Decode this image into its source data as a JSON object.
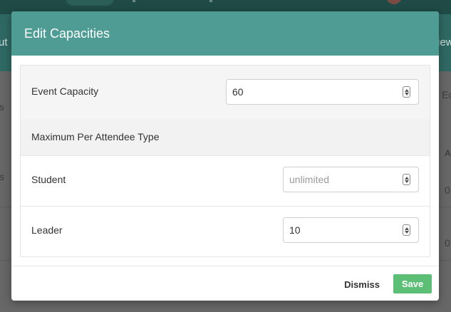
{
  "modal": {
    "title": "Edit Capacities",
    "event_capacity": {
      "label": "Event Capacity",
      "value": "60"
    },
    "max_per_type": {
      "heading": "Maximum Per Attendee Type",
      "rows": [
        {
          "label": "Student",
          "value": "",
          "placeholder": "unlimited"
        },
        {
          "label": "Leader",
          "value": "10",
          "placeholder": ""
        }
      ]
    },
    "footer": {
      "dismiss_label": "Dismiss",
      "save_label": "Save"
    }
  },
  "background": {
    "fragments": [
      "ut",
      "iew",
      "s",
      "Ec",
      "A",
      "s",
      "0",
      "0"
    ]
  },
  "colors": {
    "header": "#4e9c93",
    "save_button": "#5cbf75",
    "backdrop": "#676767"
  }
}
